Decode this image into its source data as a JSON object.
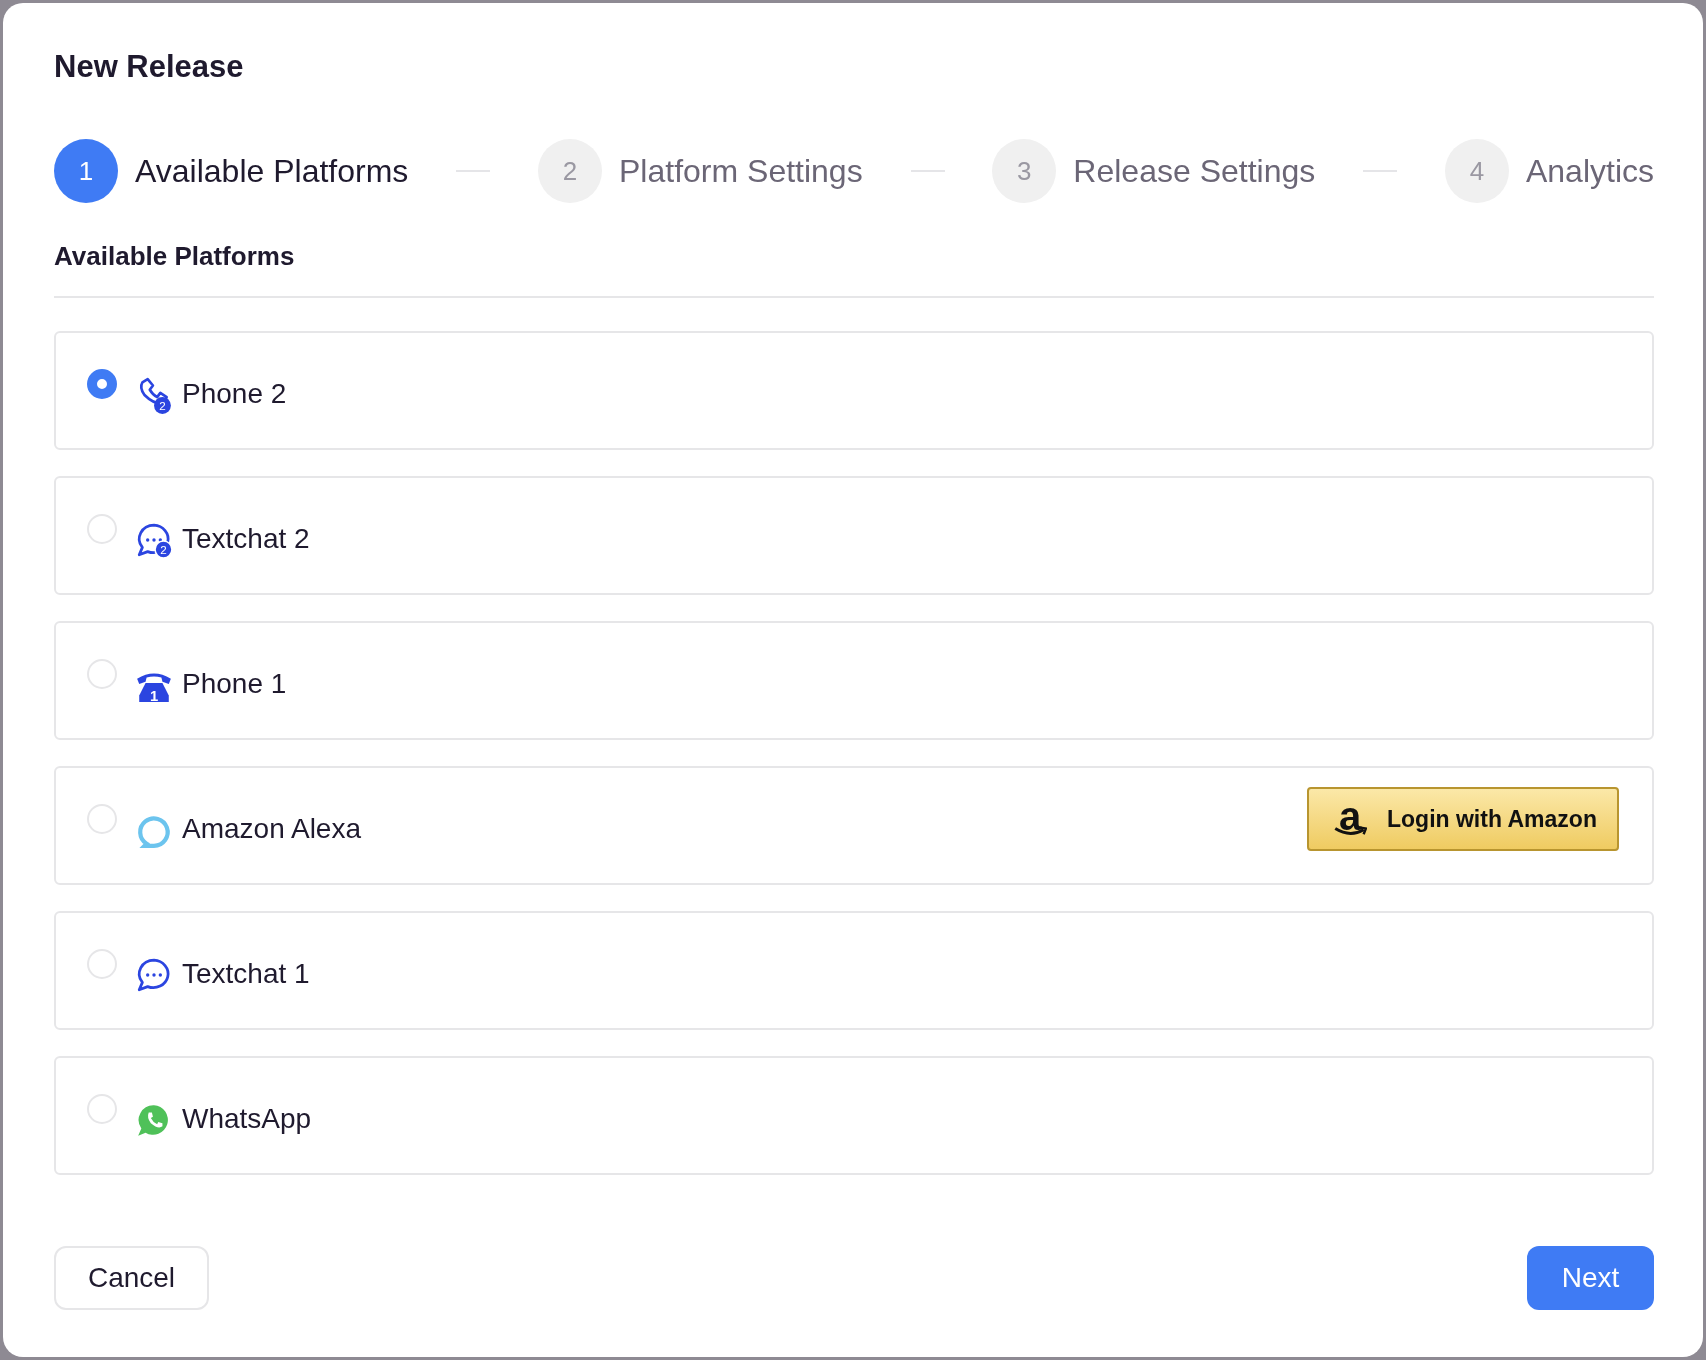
{
  "dialog": {
    "title": "New Release"
  },
  "steps": [
    {
      "number": "1",
      "label": "Available Platforms",
      "selected": true
    },
    {
      "number": "2",
      "label": "Platform Settings",
      "selected": false
    },
    {
      "number": "3",
      "label": "Release Settings",
      "selected": false
    },
    {
      "number": "4",
      "label": "Analytics",
      "selected": false
    }
  ],
  "section": {
    "title": "Available Platforms"
  },
  "platforms": [
    {
      "kind": "phone",
      "badge": "2",
      "label": "Phone 2",
      "selected": true
    },
    {
      "kind": "textchat",
      "badge": "2",
      "label": "Textchat 2",
      "selected": false
    },
    {
      "kind": "telephone",
      "badge": "1",
      "label": "Phone 1",
      "selected": false
    },
    {
      "kind": "alexa",
      "label": "Amazon Alexa",
      "selected": false,
      "action": {
        "logo": "a",
        "label": "Login with Amazon"
      }
    },
    {
      "kind": "textchat",
      "label": "Textchat 1",
      "selected": false
    },
    {
      "kind": "whatsapp",
      "label": "WhatsApp",
      "selected": false
    }
  ],
  "buttons": {
    "cancel": "Cancel",
    "next": "Next"
  }
}
